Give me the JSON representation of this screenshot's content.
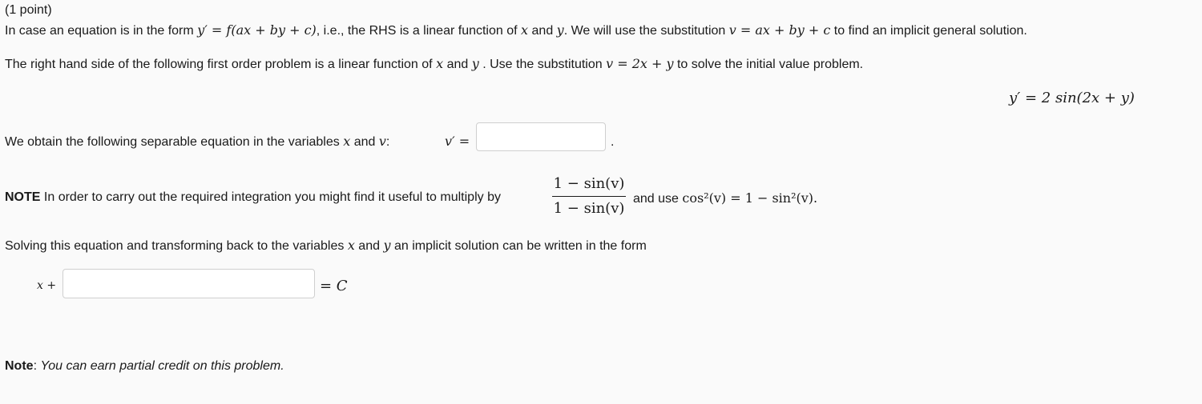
{
  "header": {
    "points": "(1 point)"
  },
  "intro": {
    "text_1": "In case an equation is in the form",
    "formula_1": "y′ = f(ax + by + c)",
    "text_2": ", i.e., the RHS is a linear function of",
    "var_x": "x",
    "text_and": "and",
    "var_y": "y",
    "text_3": ". We will use the substitution",
    "formula_2": "v = ax + by + c",
    "text_4": "to find an implicit general solution."
  },
  "problem": {
    "text_1": "The right hand side of the following first order problem is a linear function of",
    "var_x": "x",
    "text_and": "and",
    "var_y": "y",
    "text_2": ". Use the substitution",
    "formula": "v = 2x + y",
    "text_3": "to solve the initial value problem.",
    "equation": "y′ = 2 sin(2x + y)"
  },
  "separable": {
    "text_1": "We obtain the following separable equation in the variables",
    "var_x": "x",
    "text_and": "and",
    "var_v": "v",
    "colon": ":",
    "lhs": "v′ =",
    "answer_value": "",
    "period": "."
  },
  "note": {
    "label": "NOTE",
    "text_1": "In order to carry out the required integration you might find it useful to multiply by",
    "frac_num": "1 − sin(v)",
    "frac_den": "1 − sin(v)",
    "text_2": "and use",
    "identity": "cos²(v) = 1 − sin²(v)."
  },
  "implicit": {
    "text_1": "Solving this equation and transforming back to the variables",
    "var_x": "x",
    "text_and": "and",
    "var_y": "y",
    "text_2": "an implicit solution can be written in the form",
    "lhs": "x +",
    "answer_value": "",
    "rhs": "= C"
  },
  "footer": {
    "label": "Note",
    "colon": ":",
    "text": "You can earn partial credit on this problem."
  }
}
